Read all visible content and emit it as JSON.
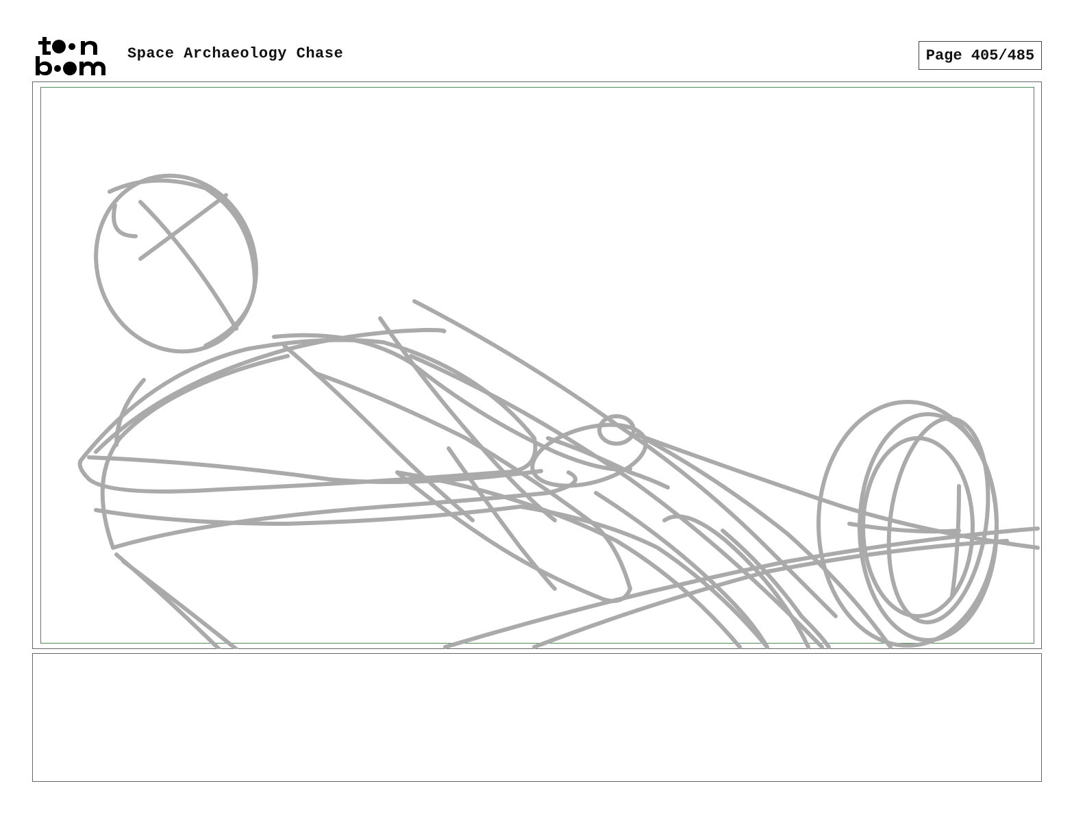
{
  "header": {
    "logo_text_top": "toon",
    "logo_text_bottom": "boom",
    "project_title": "Space Archaeology Chase",
    "page_label": "Page 405/485"
  },
  "panel": {
    "sketch_icon": "rough-pencil-sketch",
    "stroke_color": "#aaaaaa",
    "safe_area_color": "#4f8a55"
  },
  "caption": {
    "text": ""
  }
}
